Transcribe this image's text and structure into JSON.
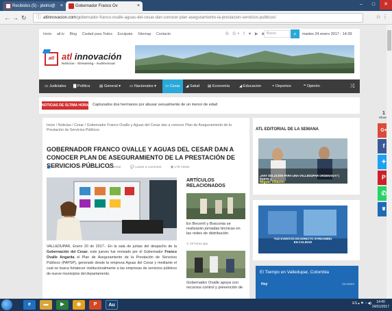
{
  "browser": {
    "tabs": [
      {
        "label": "Recibidos (5) - jdelrio@"
      },
      {
        "label": "Gobernador Franco Ov"
      }
    ],
    "url_domain": "atlinnovacion.com",
    "url_path": "/gobernador-franco-ovalle-aguas-del-cesar-dan-conocer-plan-aseguramiento-la-prestacion-servicios-publicos/"
  },
  "site": {
    "topnav": [
      "Inicio",
      "atl.tv",
      "Blog",
      "Ciudad para Todos",
      "Escápate",
      "Sitemap",
      "Contacto"
    ],
    "search_placeholder": "Busca",
    "date": "martes 24 enero 2017 - 14:39",
    "logo_prefix": "atl",
    "logo_name": "innovación",
    "logo_sub": "Noticias - Streaming - Audiovisual",
    "mainnav": [
      "Judiciales",
      "Política",
      "General",
      "Nacionales",
      "Cesar",
      "Salud",
      "Economía",
      "Educacion",
      "Deportes",
      "Opinión"
    ],
    "breaking_label": "NOTICIAS DE ÚLTIMA HORA",
    "breaking_text": "Capturados dos hermanos por abusar sexualmente de un menor de edad"
  },
  "article": {
    "breadcrumb": "Inicio / Noticias / Cesar / Gobernador Franco Ovalle y Aguas del Cesar dan a conocer Plan de Aseguramiento de la Prestación de Servicios Públicos",
    "headline": "GOBERNADOR FRANCO OVALLE Y AGUAS DEL CESAR DAN A CONOCER PLAN DE ASEGURAMIENTO DE LA PRESTACIÓN DE SERVICIOS PÚBLICOS",
    "meta": {
      "author": "atlinnovacion",
      "age": "4 días ago",
      "category": "Cesar",
      "comment": "Leave a comment",
      "views": "178 Views"
    },
    "body_lead": "VALLEDUPAR, Enero 20 de 2017.- En la sala de juntas del despacho de la ",
    "body_bold1": "Gobernación del Cesar",
    "body_mid": ", este jueves fue revisado por el Gobernador ",
    "body_bold2": "Franco Ovalle Angarita",
    "body_end": " el Plan de Aseguramiento de la Prestación de Servicios Públicos (PAPSP), generado desde la empresa Aguas del Cesar y mediante el cual se busca fortalecer institucionalmente a las empresas de servicios públicos de nueve municipios del departamento."
  },
  "related": {
    "title": "ARTÍCULOS RELACIONADOS",
    "items": [
      {
        "text": "En Becerril y Bosconia se realizarán jornadas técnicas en las redes de distribución",
        "time": "19 horas ago"
      },
      {
        "text": "Gobernador Ovalle apoya con recursos control y prevención de"
      }
    ]
  },
  "sidebar": {
    "title": "ATL EDITORIAL DE LA SEMANA",
    "editorial_caption": "¿HAY SOLUCIÓN PARA UNA VALLEDUPAR ORDENADA? | PARTE 1",
    "editorial_author": "Miguel Villazón",
    "events_caption": "TUS EVENTOS EN DIRECTO STREAMING EN CALIDAD",
    "weather_title": "El Tiempo en Valledupar, Colombia",
    "weather_today": "Hoy",
    "weather_time": "24 enero"
  },
  "share": {
    "count": "1",
    "label": "Shares"
  },
  "taskbar": {
    "tray": "ES",
    "time": "14:40",
    "date": "24/01/2017"
  },
  "colors": {
    "accent": "#2aa8d8",
    "brand_red": "#c62828",
    "nav_bg": "#3c3c3c"
  }
}
